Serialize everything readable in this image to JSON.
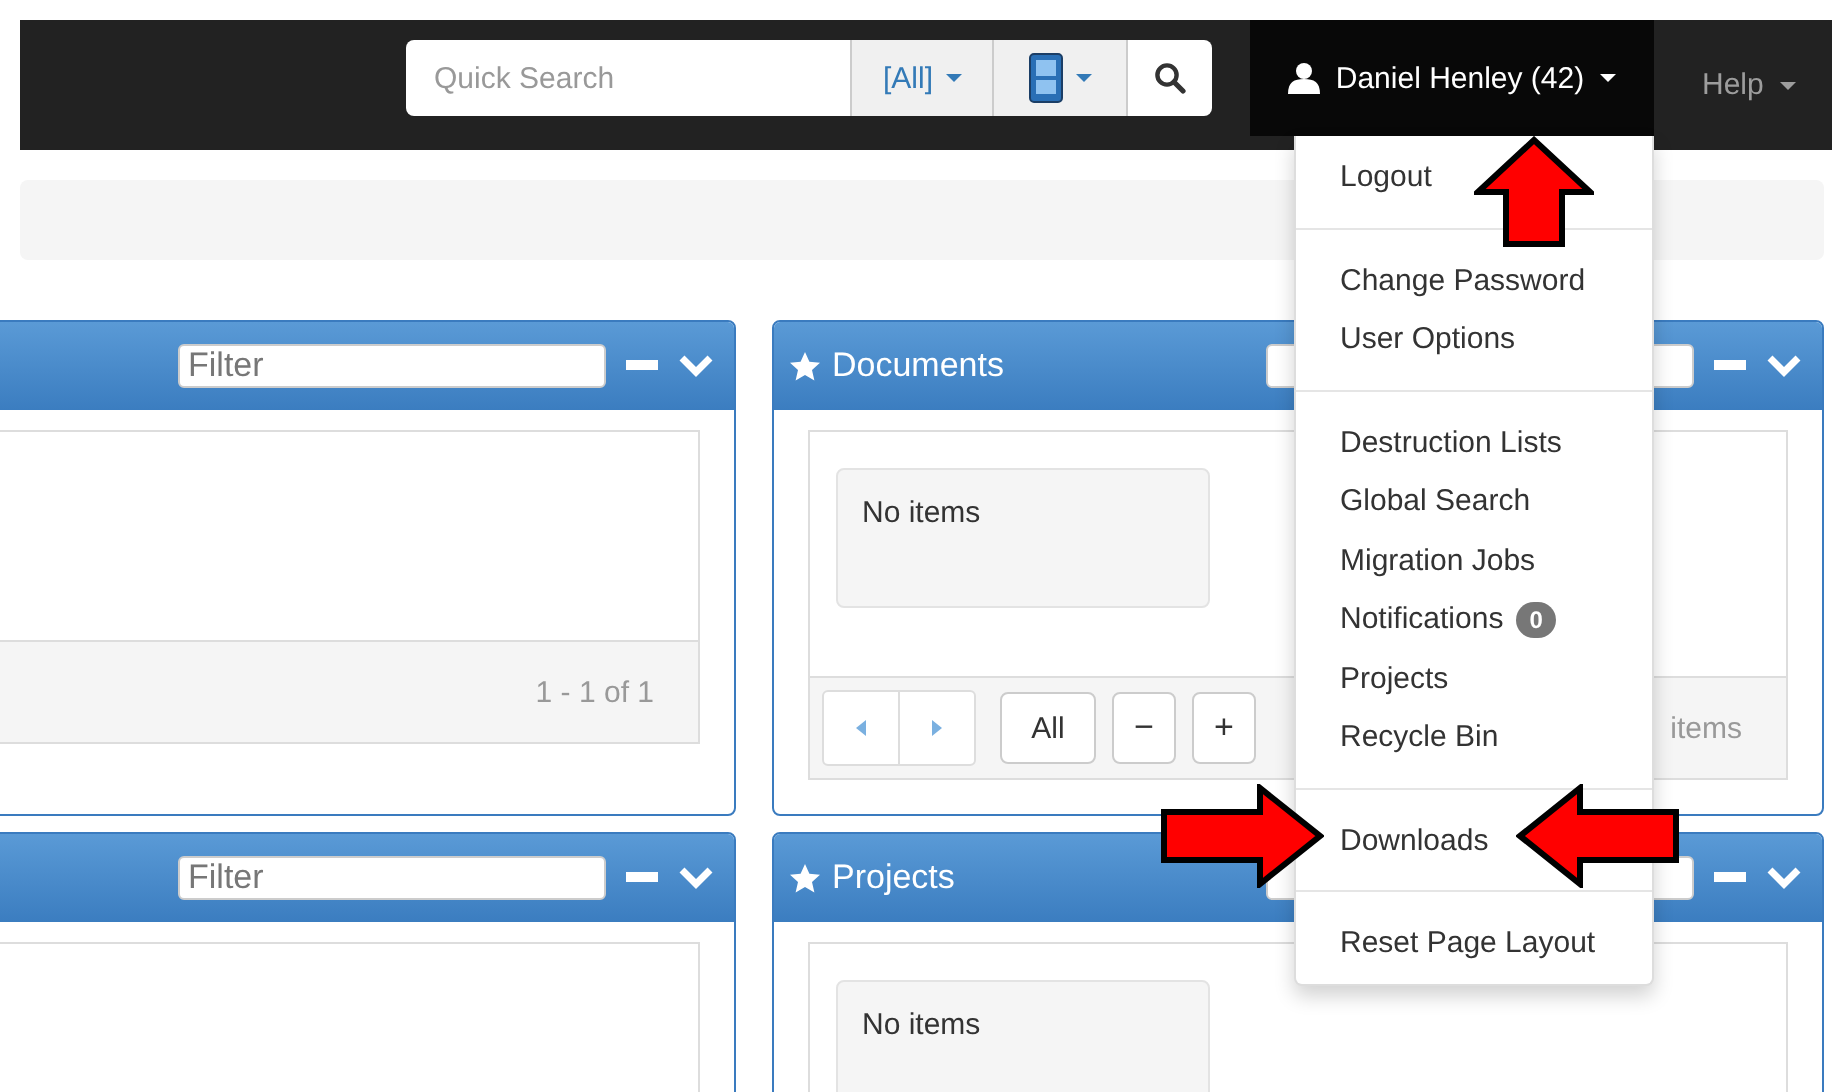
{
  "navbar": {
    "search": {
      "placeholder": "Quick Search"
    },
    "scope_dropdown": {
      "label": "[All]"
    },
    "user_menu": {
      "label": "Daniel Henley (42)",
      "expanded": true
    },
    "help_menu": {
      "label": "Help"
    }
  },
  "user_dropdown": {
    "groups": [
      {
        "items": [
          {
            "label": "Logout"
          }
        ]
      },
      {
        "items": [
          {
            "label": "Change Password"
          },
          {
            "label": "User Options"
          }
        ]
      },
      {
        "items": [
          {
            "label": "Destruction Lists"
          },
          {
            "label": "Global Search"
          },
          {
            "label": "Migration Jobs"
          },
          {
            "label": "Notifications",
            "badge": "0"
          },
          {
            "label": "Projects"
          },
          {
            "label": "Recycle Bin"
          }
        ]
      },
      {
        "items": [
          {
            "label": "Downloads"
          }
        ]
      },
      {
        "items": [
          {
            "label": "Reset Page Layout"
          }
        ]
      }
    ]
  },
  "panels": [
    {
      "kind": "list",
      "filter_placeholder": "Filter",
      "footer_text": "1 - 1 of 1"
    },
    {
      "kind": "empty",
      "title": "Documents",
      "empty_text": "No items",
      "pager": {
        "all_label": "All",
        "minus_label": "−",
        "plus_label": "+"
      },
      "footer_text": "items"
    },
    {
      "kind": "list",
      "filter_placeholder": "Filter"
    },
    {
      "kind": "empty",
      "title": "Projects",
      "empty_text": "No items"
    }
  ],
  "annotations": [
    {
      "kind": "up"
    },
    {
      "kind": "right"
    },
    {
      "kind": "left"
    }
  ]
}
